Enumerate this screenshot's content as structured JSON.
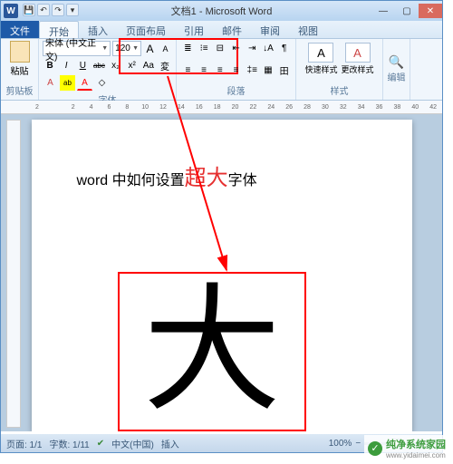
{
  "window": {
    "title": "文档1 - Microsoft Word",
    "min": "—",
    "max": "▢",
    "close": "✕"
  },
  "qat": {
    "save": "💾",
    "undo": "↶",
    "redo": "↷",
    "more": "▾"
  },
  "tabs": {
    "file": "文件",
    "home": "开始",
    "insert": "插入",
    "layout": "页面布局",
    "ref": "引用",
    "mail": "邮件",
    "review": "审阅",
    "view": "视图"
  },
  "ribbon": {
    "clipboard": {
      "label": "剪贴板",
      "paste": "粘贴"
    },
    "font": {
      "label": "字体",
      "name": "宋体 (中文正文)",
      "size": "120",
      "bold": "B",
      "italic": "I",
      "underline": "U",
      "strike": "abc",
      "sub": "x₂",
      "sup": "x²",
      "grow": "A",
      "shrink": "A",
      "case": "Aa",
      "phonetic": "変",
      "border": "A",
      "clear": "◇",
      "highlight": "ab",
      "color": "A"
    },
    "paragraph": {
      "label": "段落",
      "bullets": "≣",
      "numbers": "⁝≡",
      "multilevel": "⊟",
      "indentl": "⇤",
      "indentr": "⇥",
      "sort": "↓A",
      "show": "¶",
      "alignl": "≡",
      "alignc": "≡",
      "alignr": "≡",
      "alignj": "≡",
      "spacing": "‡≡",
      "shade": "▦",
      "borders": "田"
    },
    "styles": {
      "label": "样式",
      "quick": "快速样式",
      "change": "更改样式"
    },
    "editing": {
      "label": "编辑",
      "find": "🔍"
    }
  },
  "ruler": [
    "2",
    "",
    "2",
    "4",
    "6",
    "8",
    "10",
    "12",
    "14",
    "16",
    "18",
    "20",
    "22",
    "24",
    "26",
    "28",
    "30",
    "32",
    "34",
    "36",
    "38",
    "40",
    "42"
  ],
  "document": {
    "headline_before": "word 中如何设置",
    "headline_big": "超大",
    "headline_after": "字体",
    "big_char": "大"
  },
  "status": {
    "page": "页面: 1/1",
    "words": "字数: 1/11",
    "spell": "✔",
    "lang": "中文(中国)",
    "mode": "插入",
    "zoom": "100%",
    "minus": "−",
    "plus": "+"
  },
  "watermark": {
    "brand": "纯净系统家园",
    "url": "www.yidaimei.com"
  },
  "chart_data": {
    "type": "annotation",
    "highlight_from": "font-size-selector",
    "highlight_value": 120,
    "arrow_to": "big-char-box",
    "big_char": "大"
  }
}
